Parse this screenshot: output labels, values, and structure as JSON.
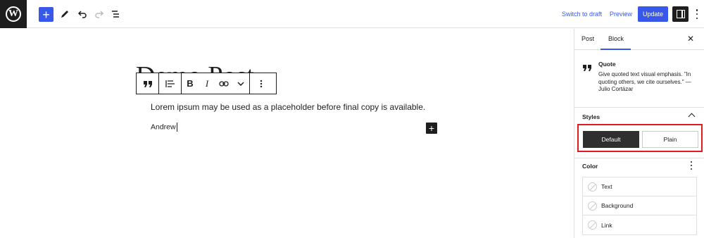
{
  "topbar": {
    "logo_letter": "W",
    "add_label": "+",
    "switch_to_draft": "Switch to draft",
    "preview": "Preview",
    "update": "Update"
  },
  "editor": {
    "title": "Demo Post",
    "paragraph": "Lorem ipsum may be used as a placeholder before final copy is available.",
    "citation": "Andrew",
    "toolbar": {
      "bold": "B",
      "italic": "I"
    },
    "inserter_label": "+"
  },
  "sidebar": {
    "tabs": [
      "Post",
      "Block"
    ],
    "active_tab": "Block",
    "close": "✕",
    "block": {
      "name": "Quote",
      "icon": "quote-icon",
      "description": "Give quoted text visual emphasis. \"In quoting others, we cite ourselves.\" — Julio Cortázar"
    },
    "styles": {
      "heading": "Styles",
      "options": [
        "Default",
        "Plain"
      ],
      "selected": "Default"
    },
    "color": {
      "heading": "Color",
      "items": [
        "Text",
        "Background",
        "Link"
      ]
    }
  },
  "colors": {
    "accent": "#3858e9",
    "highlight": "#e01b24",
    "dark": "#1e1e1e"
  }
}
